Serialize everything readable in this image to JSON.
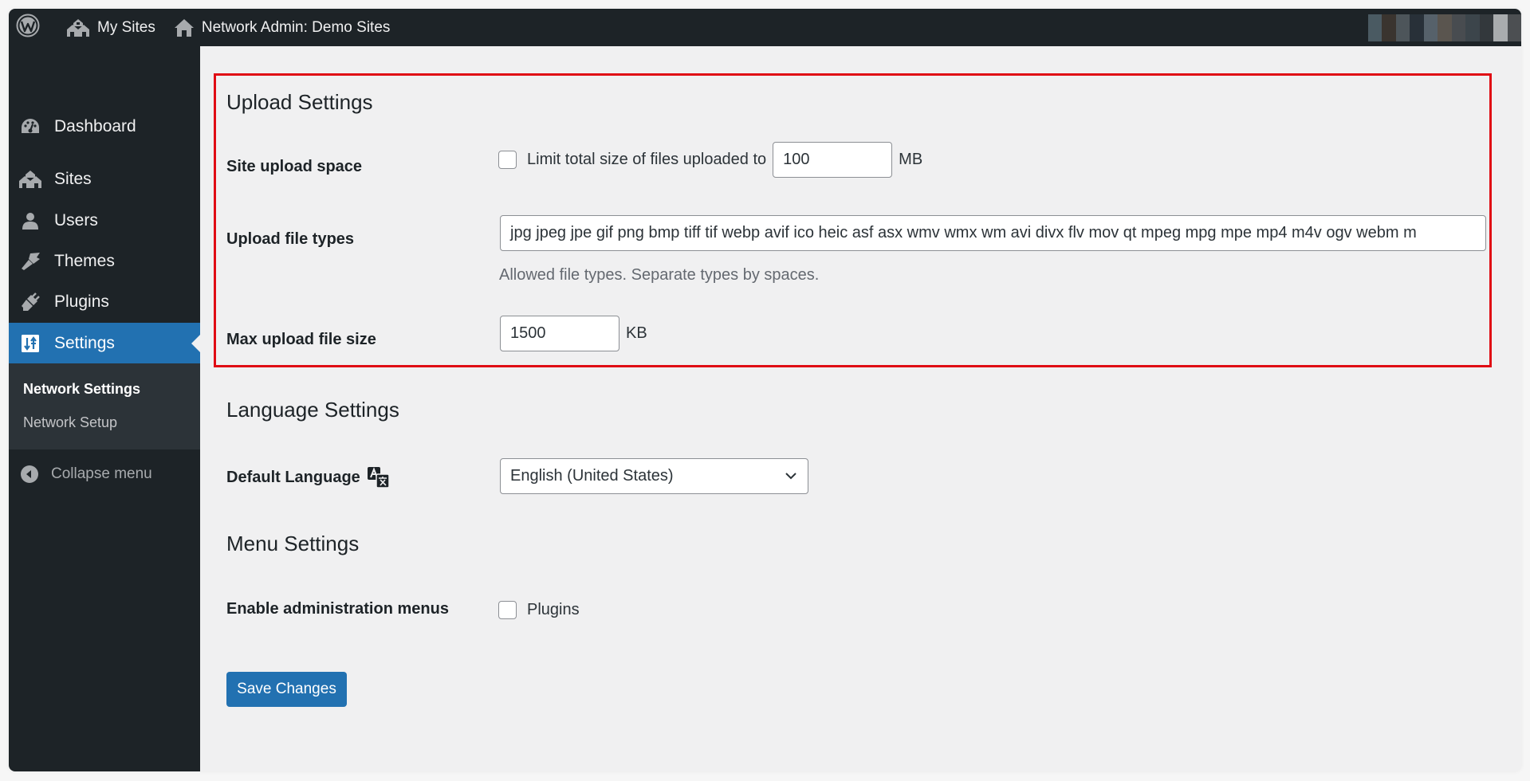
{
  "adminbar": {
    "wp_logo_icon": "wordpress-logo-icon",
    "my_sites_label": "My Sites",
    "my_sites_icon": "multisite-houses-icon",
    "network_label": "Network Admin: Demo Sites",
    "network_icon": "home-icon",
    "avatar": "pixelated-user-avatar"
  },
  "colors": {
    "sidebar_bg": "#1d2327",
    "submenu_bg": "#2c3338",
    "accent": "#2271b1",
    "highlight_border": "#e00b14",
    "content_bg": "#f0f0f1"
  },
  "sidebar": {
    "items": [
      {
        "label": "Dashboard",
        "icon": "dashboard-gauge-icon"
      },
      {
        "label": "Sites",
        "icon": "multisite-houses-icon"
      },
      {
        "label": "Users",
        "icon": "user-icon"
      },
      {
        "label": "Themes",
        "icon": "paintbrush-icon"
      },
      {
        "label": "Plugins",
        "icon": "plugin-plug-icon"
      },
      {
        "label": "Settings",
        "icon": "settings-sliders-icon",
        "current": true
      }
    ],
    "submenu": [
      {
        "label": "Network Settings",
        "current": true
      },
      {
        "label": "Network Setup"
      }
    ],
    "collapse_label": "Collapse menu",
    "collapse_icon": "collapse-arrow-left-icon"
  },
  "upload": {
    "heading": "Upload Settings",
    "site_upload_space": {
      "label": "Site upload space",
      "checkbox_label": "Limit total size of files uploaded to",
      "checked": false,
      "value": "100",
      "unit": "MB"
    },
    "file_types": {
      "label": "Upload file types",
      "value": "jpg jpeg jpe gif png bmp tiff tif webp avif ico heic asf asx wmv wmx wm avi divx flv mov qt mpeg mpg mpe mp4 m4v ogv webm m",
      "description": "Allowed file types. Separate types by spaces."
    },
    "max_upload": {
      "label": "Max upload file size",
      "value": "1500",
      "unit": "KB"
    }
  },
  "language": {
    "heading": "Language Settings",
    "default_label": "Default Language",
    "translate_icon": "translation-icon",
    "selected": "English (United States)"
  },
  "menu_settings": {
    "heading": "Menu Settings",
    "label": "Enable administration menus",
    "checkbox_label": "Plugins",
    "checked": false
  },
  "save_label": "Save Changes"
}
